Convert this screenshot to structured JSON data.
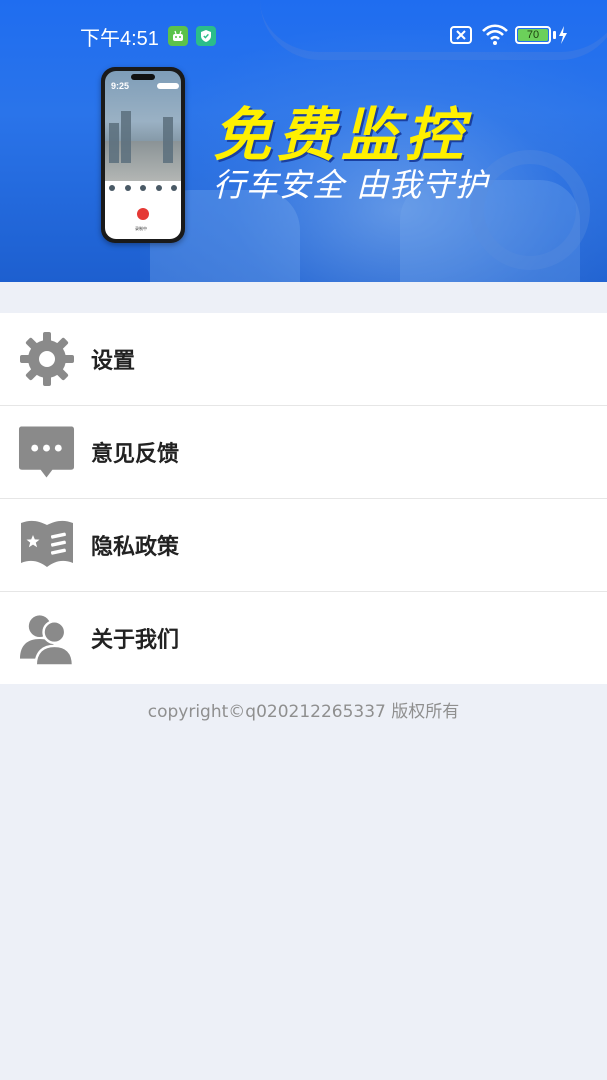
{
  "status_bar": {
    "time": "下午4:51",
    "battery": "70"
  },
  "banner": {
    "headline": "免费监控",
    "subheadline": "行车安全 由我守护",
    "phone": {
      "time": "9:25",
      "record_label": "录制中"
    }
  },
  "menu": {
    "items": [
      {
        "label": "设置",
        "icon": "gear-icon"
      },
      {
        "label": "意见反馈",
        "icon": "chat-bubble-icon"
      },
      {
        "label": "隐私政策",
        "icon": "policy-book-icon"
      },
      {
        "label": "关于我们",
        "icon": "users-icon"
      }
    ]
  },
  "footer": {
    "copyright": "copyright©q020212265337 版权所有"
  },
  "colors": {
    "banner_blue": "#1f6df0",
    "headline_yellow": "#fff000",
    "icon_gray": "#8a8a8a",
    "page_bg": "#edf0f7"
  }
}
